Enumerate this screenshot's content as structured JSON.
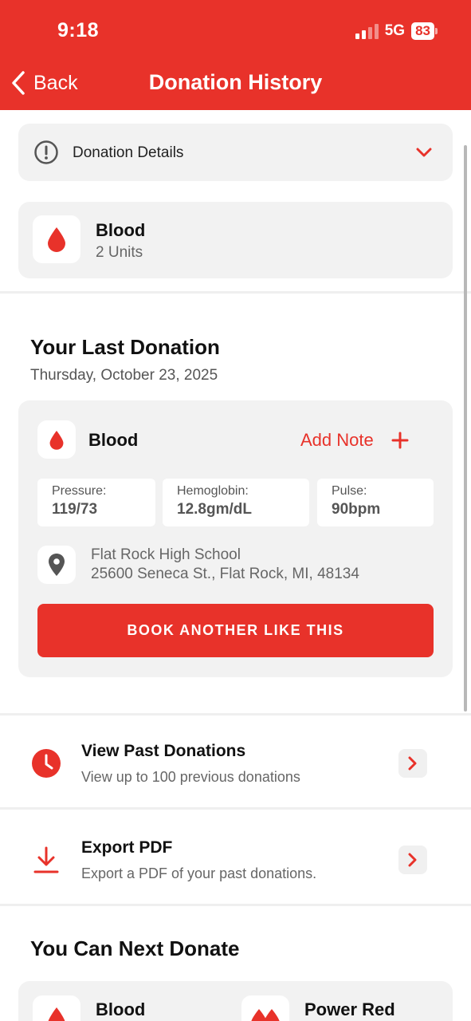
{
  "status_bar": {
    "time": "9:18",
    "network": "5G",
    "battery": "83"
  },
  "header": {
    "back_label": "Back",
    "title": "Donation History"
  },
  "details": {
    "label": "Donation Details"
  },
  "donation_summary": {
    "type": "Blood",
    "units": "2 Units"
  },
  "last_donation": {
    "heading": "Your Last Donation",
    "date": "Thursday, October 23, 2025",
    "type": "Blood",
    "add_note": "Add Note",
    "metrics": [
      {
        "label": "Pressure:",
        "value": "119/73"
      },
      {
        "label": "Hemoglobin:",
        "value": "12.8gm/dL"
      },
      {
        "label": "Pulse:",
        "value": "90bpm"
      }
    ],
    "location_name": "Flat Rock High School",
    "location_address": "25600 Seneca St., Flat Rock, MI, 48134",
    "book_button": "BOOK ANOTHER LIKE THIS"
  },
  "actions": [
    {
      "title": "View Past Donations",
      "subtitle": "View up to 100 previous donations"
    },
    {
      "title": "Export PDF",
      "subtitle": "Export a PDF of your past donations."
    }
  ],
  "next_donate": {
    "heading": "You Can Next Donate",
    "items": [
      {
        "label": "Blood"
      },
      {
        "label": "Power Red"
      }
    ]
  },
  "colors": {
    "brand": "#e8322a",
    "card": "#f2f2f2"
  }
}
